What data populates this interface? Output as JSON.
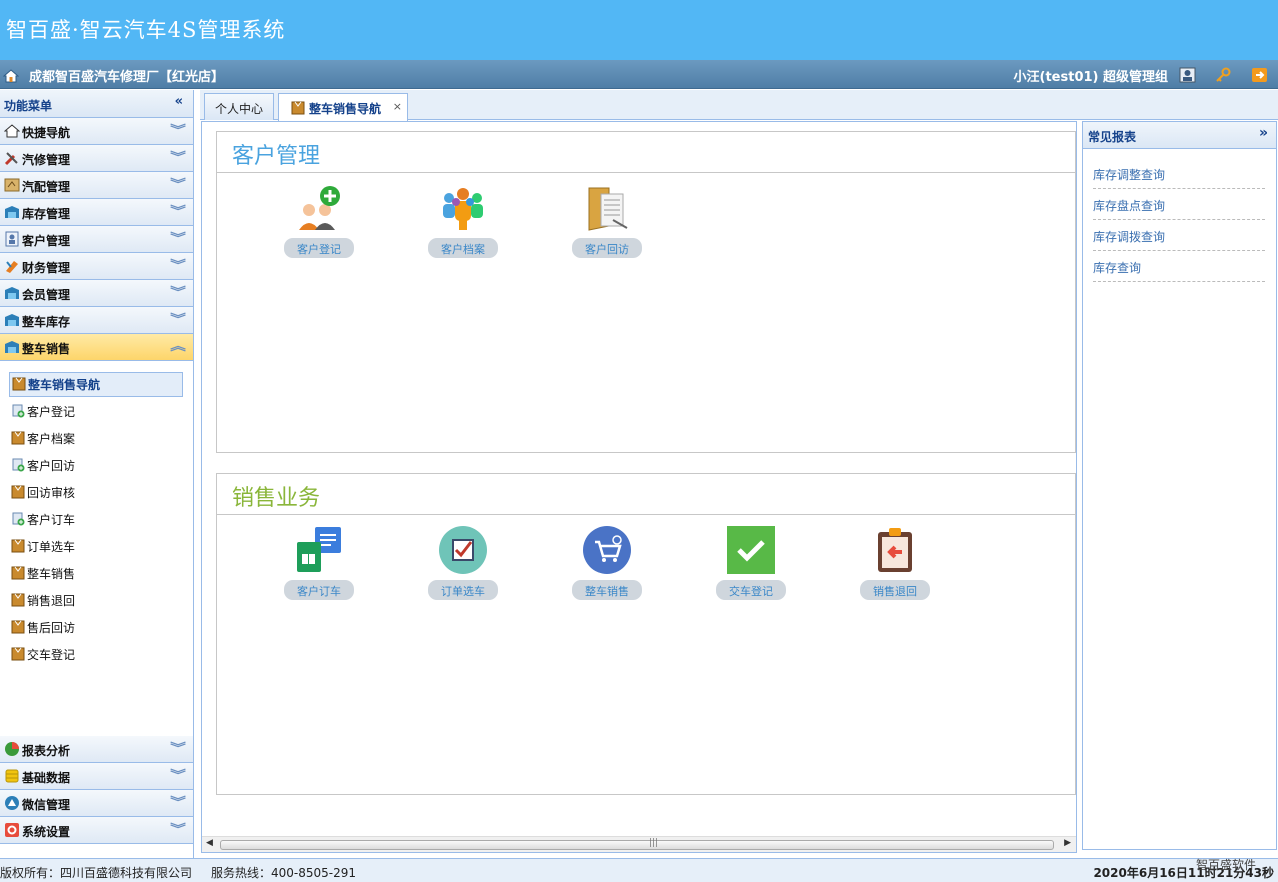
{
  "app": {
    "title": "智百盛·智云汽车4S管理系统",
    "shop_name": "成都智百盛汽车修理厂【红光店】",
    "user": "小汪(test01)  超级管理组"
  },
  "left_menu": {
    "header": "功能菜单",
    "groups_top": [
      {
        "label": "快捷导航",
        "icon": "home-icon"
      },
      {
        "label": "汽修管理",
        "icon": "wrench-icon"
      },
      {
        "label": "汽配管理",
        "icon": "parts-icon"
      },
      {
        "label": "库存管理",
        "icon": "warehouse-icon"
      },
      {
        "label": "客户管理",
        "icon": "customer-icon"
      },
      {
        "label": "财务管理",
        "icon": "finance-icon"
      },
      {
        "label": "会员管理",
        "icon": "member-icon"
      },
      {
        "label": "整车库存",
        "icon": "vehicle-stock-icon"
      }
    ],
    "active_group": {
      "label": "整车销售",
      "icon": "vehicle-sales-icon"
    },
    "sub_items": [
      {
        "label": "整车销售导航"
      },
      {
        "label": "客户登记"
      },
      {
        "label": "客户档案"
      },
      {
        "label": "客户回访"
      },
      {
        "label": "回访审核"
      },
      {
        "label": "客户订车"
      },
      {
        "label": "订单选车"
      },
      {
        "label": "整车销售"
      },
      {
        "label": "销售退回"
      },
      {
        "label": "售后回访"
      },
      {
        "label": "交车登记"
      }
    ],
    "groups_bottom": [
      {
        "label": "报表分析",
        "icon": "pie-chart-icon"
      },
      {
        "label": "基础数据",
        "icon": "database-icon"
      },
      {
        "label": "微信管理",
        "icon": "wechat-icon"
      },
      {
        "label": "系统设置",
        "icon": "settings-icon"
      }
    ]
  },
  "tabs": [
    {
      "label": "个人中心"
    },
    {
      "label": "整车销售导航",
      "close": "×"
    }
  ],
  "sections": [
    {
      "title": "客户管理",
      "color": "#4aa3df",
      "items": [
        {
          "label": "客户登记",
          "icon": "add-customer-icon"
        },
        {
          "label": "客户档案",
          "icon": "people-group-icon"
        },
        {
          "label": "客户回访",
          "icon": "folder-icon"
        }
      ]
    },
    {
      "title": "销售业务",
      "color": "#8ab63a",
      "items": [
        {
          "label": "客户订车",
          "icon": "document-icon"
        },
        {
          "label": "订单选车",
          "icon": "checkbox-icon"
        },
        {
          "label": "整车销售",
          "icon": "cart-icon"
        },
        {
          "label": "交车登记",
          "icon": "check-icon"
        },
        {
          "label": "销售退回",
          "icon": "return-clipboard-icon"
        }
      ]
    }
  ],
  "right_panel": {
    "title": "常见报表",
    "links": [
      {
        "label": "库存调整查询"
      },
      {
        "label": "库存盘点查询"
      },
      {
        "label": "库存调拨查询"
      },
      {
        "label": "库存查询"
      }
    ]
  },
  "footer": {
    "copyright": "版权所有：四川百盛德科技有限公司",
    "hotline": "服务热线：400-8505-291",
    "datetime": "2020年6月16日11时21分43秒",
    "watermark": "智百盛软件"
  }
}
